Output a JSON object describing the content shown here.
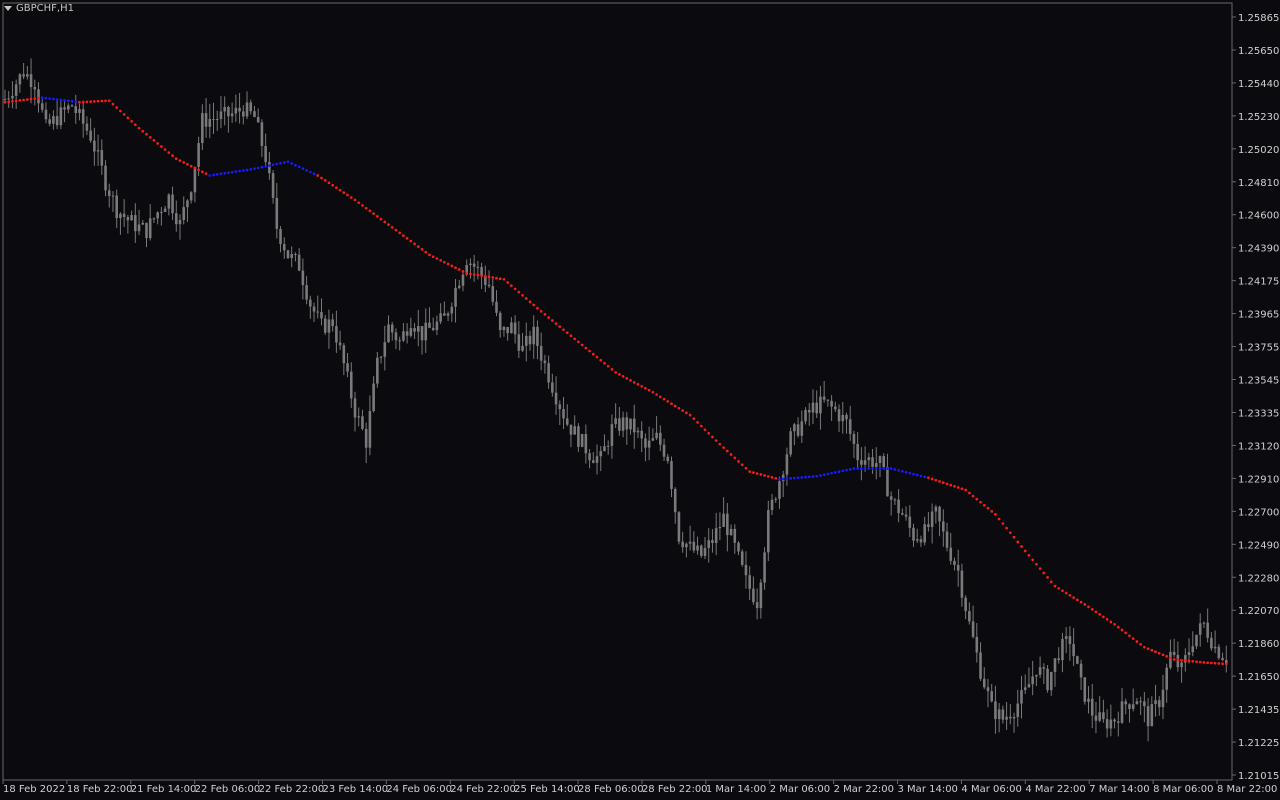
{
  "window": {
    "symbol_title": "GBPCHF,H1"
  },
  "colors": {
    "background": "#0a0a0f",
    "frame": "#6a6a6a",
    "candle": "#7a7a7a",
    "ma_down": "#ff1a1a",
    "ma_up": "#1a1aff",
    "axis_text": "#d0d0d0"
  },
  "icons": {
    "dropdown": "triangle-down-icon"
  },
  "chart_data": {
    "type": "line",
    "title": "GBPCHF,H1",
    "xlabel": "",
    "ylabel": "",
    "ylim": [
      1.2088,
      1.2597
    ],
    "grid": false,
    "y_ticks": [
      "1.25865",
      "1.25650",
      "1.25440",
      "1.25230",
      "1.25020",
      "1.24810",
      "1.24600",
      "1.24390",
      "1.24175",
      "1.23965",
      "1.23755",
      "1.23545",
      "1.23335",
      "1.23120",
      "1.22910",
      "1.22700",
      "1.22490",
      "1.22280",
      "1.22070",
      "1.21860",
      "1.21650",
      "1.21435",
      "1.21225",
      "1.21015"
    ],
    "x_ticks": [
      "18 Feb 2022",
      "18 Feb 22:00",
      "21 Feb 14:00",
      "22 Feb 06:00",
      "22 Feb 22:00",
      "23 Feb 14:00",
      "24 Feb 06:00",
      "24 Feb 22:00",
      "25 Feb 14:00",
      "28 Feb 06:00",
      "28 Feb 22:00",
      "1 Mar 14:00",
      "2 Mar 06:00",
      "2 Mar 22:00",
      "3 Mar 14:00",
      "4 Mar 06:00",
      "4 Mar 22:00",
      "7 Mar 14:00",
      "8 Mar 06:00",
      "8 Mar 22:00"
    ],
    "price_path": [
      [
        0,
        1.2534
      ],
      [
        5,
        1.2552
      ],
      [
        8,
        1.2545
      ],
      [
        11,
        1.2515
      ],
      [
        14,
        1.2522
      ],
      [
        18,
        1.253
      ],
      [
        20,
        1.2522
      ],
      [
        23,
        1.251
      ],
      [
        27,
        1.248
      ],
      [
        30,
        1.2462
      ],
      [
        33,
        1.2455
      ],
      [
        36,
        1.245
      ],
      [
        38,
        1.2448
      ],
      [
        41,
        1.246
      ],
      [
        44,
        1.247
      ],
      [
        47,
        1.2452
      ],
      [
        50,
        1.2478
      ],
      [
        53,
        1.252
      ],
      [
        57,
        1.2522
      ],
      [
        61,
        1.2524
      ],
      [
        64,
        1.2528
      ],
      [
        67,
        1.2522
      ],
      [
        70,
        1.2496
      ],
      [
        73,
        1.245
      ],
      [
        76,
        1.2432
      ],
      [
        79,
        1.2425
      ],
      [
        82,
        1.24
      ],
      [
        85,
        1.2385
      ],
      [
        88,
        1.2388
      ],
      [
        91,
        1.236
      ],
      [
        94,
        1.233
      ],
      [
        97,
        1.231
      ],
      [
        100,
        1.236
      ],
      [
        103,
        1.2385
      ],
      [
        106,
        1.2375
      ],
      [
        109,
        1.239
      ],
      [
        112,
        1.238
      ],
      [
        115,
        1.2385
      ],
      [
        118,
        1.239
      ],
      [
        121,
        1.241
      ],
      [
        124,
        1.243
      ],
      [
        127,
        1.2422
      ],
      [
        130,
        1.2412
      ],
      [
        133,
        1.238
      ],
      [
        136,
        1.2385
      ],
      [
        139,
        1.237
      ],
      [
        142,
        1.238
      ],
      [
        145,
        1.236
      ],
      [
        148,
        1.234
      ],
      [
        151,
        1.2322
      ],
      [
        154,
        1.2312
      ],
      [
        157,
        1.2302
      ],
      [
        160,
        1.2298
      ],
      [
        163,
        1.2318
      ],
      [
        166,
        1.2322
      ],
      [
        169,
        1.2318
      ],
      [
        172,
        1.2305
      ],
      [
        175,
        1.2312
      ],
      [
        178,
        1.23
      ],
      [
        181,
        1.2248
      ],
      [
        184,
        1.224
      ],
      [
        187,
        1.2235
      ],
      [
        190,
        1.2245
      ],
      [
        193,
        1.226
      ],
      [
        196,
        1.224
      ],
      [
        199,
        1.2218
      ],
      [
        202,
        1.2205
      ],
      [
        205,
        1.226
      ],
      [
        208,
        1.2285
      ],
      [
        211,
        1.2312
      ],
      [
        214,
        1.2322
      ],
      [
        217,
        1.2332
      ],
      [
        220,
        1.2335
      ],
      [
        223,
        1.233
      ],
      [
        226,
        1.2322
      ],
      [
        229,
        1.23
      ],
      [
        232,
        1.2298
      ],
      [
        235,
        1.2295
      ],
      [
        238,
        1.2272
      ],
      [
        241,
        1.2262
      ],
      [
        244,
        1.2248
      ],
      [
        247,
        1.225
      ],
      [
        250,
        1.2262
      ],
      [
        253,
        1.2242
      ],
      [
        256,
        1.2225
      ],
      [
        259,
        1.219
      ],
      [
        262,
        1.216
      ],
      [
        265,
        1.2135
      ],
      [
        268,
        1.2128
      ],
      [
        271,
        1.2135
      ],
      [
        274,
        1.2145
      ],
      [
        277,
        1.2162
      ],
      [
        280,
        1.2152
      ],
      [
        283,
        1.2172
      ],
      [
        286,
        1.218
      ],
      [
        289,
        1.215
      ],
      [
        292,
        1.2132
      ],
      [
        295,
        1.2125
      ],
      [
        298,
        1.2128
      ],
      [
        301,
        1.2138
      ],
      [
        304,
        1.2142
      ],
      [
        307,
        1.2128
      ],
      [
        310,
        1.214
      ],
      [
        313,
        1.217
      ],
      [
        316,
        1.216
      ],
      [
        319,
        1.218
      ],
      [
        322,
        1.219
      ],
      [
        325,
        1.2175
      ],
      [
        328,
        1.2168
      ]
    ],
    "series": [
      {
        "name": "",
        "type": "dotted-line",
        "points": [
          [
            0,
            1.2532
          ],
          [
            10,
            1.2535
          ],
          [
            20,
            1.2532
          ],
          [
            28,
            1.2533
          ],
          [
            36,
            1.2515
          ],
          [
            46,
            1.2495
          ],
          [
            55,
            1.2484
          ],
          [
            66,
            1.2488
          ],
          [
            76,
            1.2493
          ],
          [
            84,
            1.2484
          ],
          [
            94,
            1.2468
          ],
          [
            104,
            1.245
          ],
          [
            114,
            1.2432
          ],
          [
            124,
            1.242
          ],
          [
            134,
            1.2416
          ],
          [
            144,
            1.2395
          ],
          [
            154,
            1.2375
          ],
          [
            164,
            1.2355
          ],
          [
            174,
            1.2342
          ],
          [
            184,
            1.2327
          ],
          [
            192,
            1.2308
          ],
          [
            200,
            1.229
          ],
          [
            208,
            1.2285
          ],
          [
            218,
            1.2287
          ],
          [
            228,
            1.2292
          ],
          [
            238,
            1.2292
          ],
          [
            248,
            1.2286
          ],
          [
            258,
            1.2278
          ],
          [
            266,
            1.2262
          ],
          [
            274,
            1.2238
          ],
          [
            282,
            1.2215
          ],
          [
            290,
            1.2203
          ],
          [
            298,
            1.219
          ],
          [
            306,
            1.2175
          ],
          [
            314,
            1.2167
          ],
          [
            322,
            1.2165
          ],
          [
            328,
            1.2164
          ]
        ],
        "direction": [
          "down",
          "up",
          "down",
          "down",
          "down",
          "down",
          "up",
          "up",
          "up",
          "down",
          "down",
          "down",
          "down",
          "down",
          "down",
          "down",
          "down",
          "down",
          "down",
          "down",
          "down",
          "down",
          "up",
          "up",
          "up",
          "up",
          "down",
          "down",
          "down",
          "down",
          "down",
          "down",
          "down",
          "down",
          "down",
          "down",
          "down"
        ]
      }
    ]
  }
}
